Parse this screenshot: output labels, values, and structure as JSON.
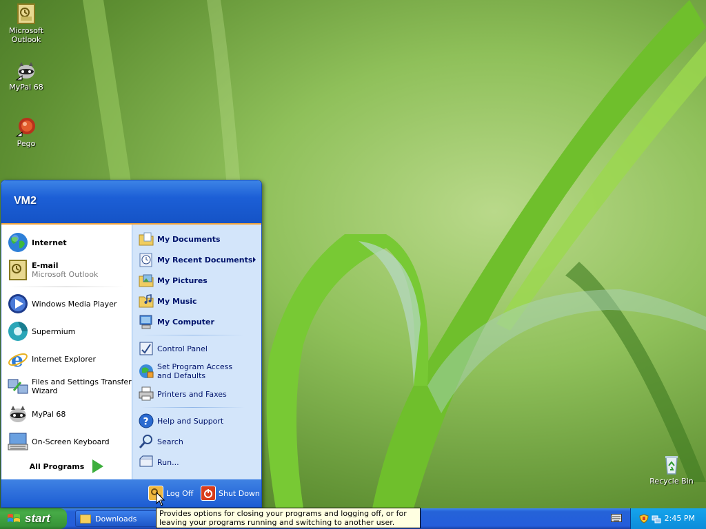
{
  "desktop": {
    "icons": [
      {
        "label": "Microsoft Outlook",
        "icon": "outlook-icon"
      },
      {
        "label": "MyPal 68",
        "icon": "raccoon-icon"
      },
      {
        "label": "Pego",
        "icon": "pego-icon"
      },
      {
        "label": "Recycle Bin",
        "icon": "recycle-bin-icon"
      }
    ]
  },
  "start_menu": {
    "user_name": "VM2",
    "pinned": [
      {
        "label": "Internet",
        "icon": "globe-icon"
      },
      {
        "label": "E-mail",
        "sublabel": "Microsoft Outlook",
        "icon": "outlook-icon"
      }
    ],
    "recent": [
      {
        "label": "Windows Media Player",
        "icon": "media-player-icon"
      },
      {
        "label": "Supermium",
        "icon": "supermium-icon"
      },
      {
        "label": "Internet Explorer",
        "icon": "ie-icon"
      },
      {
        "label": "Files and Settings Transfer Wizard",
        "icon": "transfer-wizard-icon"
      },
      {
        "label": "MyPal 68",
        "icon": "raccoon-icon"
      },
      {
        "label": "On-Screen Keyboard",
        "icon": "keyboard-icon"
      }
    ],
    "all_programs": "All Programs",
    "places": [
      {
        "label": "My Documents",
        "icon": "folder-documents-icon"
      },
      {
        "label": "My Recent Documents",
        "icon": "recent-documents-icon"
      },
      {
        "label": "My Pictures",
        "icon": "folder-pictures-icon"
      },
      {
        "label": "My Music",
        "icon": "folder-music-icon"
      },
      {
        "label": "My Computer",
        "icon": "computer-icon"
      }
    ],
    "system": [
      {
        "label": "Control Panel",
        "icon": "control-panel-icon"
      },
      {
        "label": "Set Program Access and Defaults",
        "icon": "program-access-icon"
      },
      {
        "label": "Printers and Faxes",
        "icon": "printer-icon"
      }
    ],
    "help": [
      {
        "label": "Help and Support",
        "icon": "help-icon"
      },
      {
        "label": "Search",
        "icon": "search-icon"
      },
      {
        "label": "Run...",
        "icon": "run-icon"
      }
    ],
    "footer": {
      "log_off": "Log Off",
      "shut_down": "Shut Down"
    }
  },
  "taskbar": {
    "start_label": "start",
    "tasks": [
      {
        "label": "Downloads",
        "icon": "folder-icon"
      }
    ],
    "clock": "2:45 PM"
  },
  "tooltip": {
    "text": "Provides options for closing your programs and logging off, or for leaving your programs running and switching to another user."
  }
}
